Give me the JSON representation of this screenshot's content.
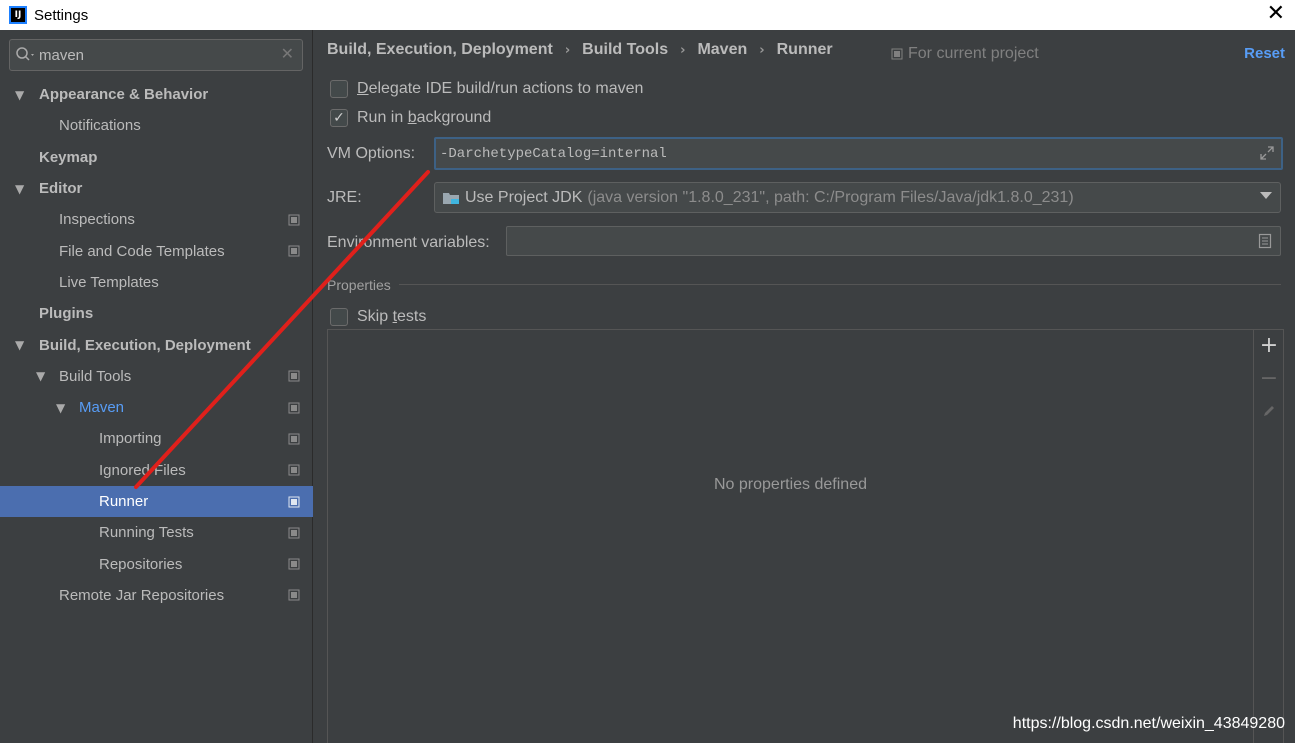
{
  "window": {
    "title": "Settings",
    "app_icon": "IJ"
  },
  "search": {
    "value": "maven"
  },
  "tree": [
    {
      "label": "Appearance & Behavior",
      "level": 0,
      "expanded": true,
      "bold": true,
      "has_project_icon": false
    },
    {
      "label": "Notifications",
      "level": 1,
      "bold": false,
      "has_project_icon": false
    },
    {
      "label": "Keymap",
      "level": 0,
      "bold": true,
      "has_project_icon": false
    },
    {
      "label": "Editor",
      "level": 0,
      "expanded": true,
      "bold": true,
      "has_project_icon": false
    },
    {
      "label": "Inspections",
      "level": 1,
      "bold": false,
      "has_project_icon": true
    },
    {
      "label": "File and Code Templates",
      "level": 1,
      "bold": false,
      "has_project_icon": true
    },
    {
      "label": "Live Templates",
      "level": 1,
      "bold": false,
      "has_project_icon": false
    },
    {
      "label": "Plugins",
      "level": 0,
      "bold": true,
      "has_project_icon": false
    },
    {
      "label": "Build, Execution, Deployment",
      "level": 0,
      "expanded": true,
      "bold": true,
      "has_project_icon": false
    },
    {
      "label": "Build Tools",
      "level": 1,
      "expanded": true,
      "bold": false,
      "has_project_icon": true
    },
    {
      "label": "Maven",
      "level": 2,
      "expanded": true,
      "bold": false,
      "has_project_icon": true,
      "highlight": true
    },
    {
      "label": "Importing",
      "level": 3,
      "bold": false,
      "has_project_icon": true
    },
    {
      "label": "Ignored Files",
      "level": 3,
      "bold": false,
      "has_project_icon": true
    },
    {
      "label": "Runner",
      "level": 3,
      "bold": false,
      "has_project_icon": true,
      "selected": true
    },
    {
      "label": "Running Tests",
      "level": 3,
      "bold": false,
      "has_project_icon": true
    },
    {
      "label": "Repositories",
      "level": 3,
      "bold": false,
      "has_project_icon": true
    },
    {
      "label": "Remote Jar Repositories",
      "level": 1,
      "bold": false,
      "has_project_icon": true
    }
  ],
  "breadcrumb": [
    "Build, Execution, Deployment",
    "Build Tools",
    "Maven",
    "Runner"
  ],
  "for_project": "For current project",
  "reset_label": "Reset",
  "delegate": {
    "label_pre": "",
    "label_ul": "D",
    "label_post": "elegate IDE build/run actions to maven",
    "checked": false
  },
  "run_bg": {
    "label_pre": "Run in ",
    "label_ul": "b",
    "label_post": "ackground",
    "checked": true
  },
  "vm_options": {
    "label": "VM Options:",
    "value": "-DarchetypeCatalog=internal"
  },
  "jre": {
    "label": "JRE:",
    "main": "Use Project JDK",
    "detail": "(java version \"1.8.0_231\", path: C:/Program Files/Java/jdk1.8.0_231)"
  },
  "env": {
    "label": "Environment variables:",
    "value": ""
  },
  "properties": {
    "title": "Properties",
    "empty_text": "No properties defined"
  },
  "skip_tests": {
    "label_pre": "Skip ",
    "label_ul": "t",
    "label_post": "ests",
    "checked": false
  },
  "watermark": "https://blog.csdn.net/weixin_43849280",
  "colors": {
    "background": "#3c3f41",
    "selection": "#4b6eaf",
    "link": "#589df6",
    "annotation": "#e0201b"
  }
}
